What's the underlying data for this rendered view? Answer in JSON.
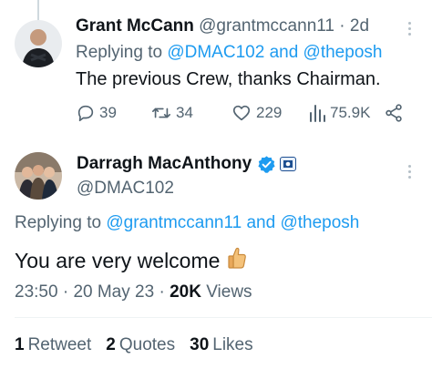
{
  "reply_tweet": {
    "author_name": "Grant McCann",
    "author_handle": "@grantmccann11",
    "separator": "·",
    "time": "2d",
    "replying_prefix": "Replying to",
    "replying_user1": "@DMAC102",
    "replying_and": "and",
    "replying_user2": "@theposh",
    "text": "The previous Crew, thanks Chairman.",
    "replies": "39",
    "retweets": "34",
    "likes": "229",
    "views": "75.9K"
  },
  "main_tweet": {
    "author_name": "Darragh MacAnthony",
    "author_handle": "@DMAC102",
    "replying_prefix": "Replying to",
    "replying_user1": "@grantmccann11",
    "replying_and": "and",
    "replying_user2": "@theposh",
    "text": "You are very welcome",
    "time": "23:50",
    "date_sep": "·",
    "date": "20 May 23",
    "views_sep": "·",
    "views_count": "20K",
    "views_label": "Views"
  },
  "engagement": {
    "retweets_count": "1",
    "retweets_label": "Retweet",
    "quotes_count": "2",
    "quotes_label": "Quotes",
    "likes_count": "30",
    "likes_label": "Likes"
  },
  "icons": {
    "reply": "reply-icon",
    "retweet": "retweet-icon",
    "like": "heart-icon",
    "views": "views-icon",
    "share": "share-icon",
    "verified": "verified-icon",
    "affiliate": "affiliate-badge-icon",
    "emoji": "thumbs-up-emoji",
    "more": "more-icon"
  },
  "colors": {
    "link": "#1d9bf0",
    "secondary_text": "#536471",
    "primary_text": "#0f1419"
  }
}
